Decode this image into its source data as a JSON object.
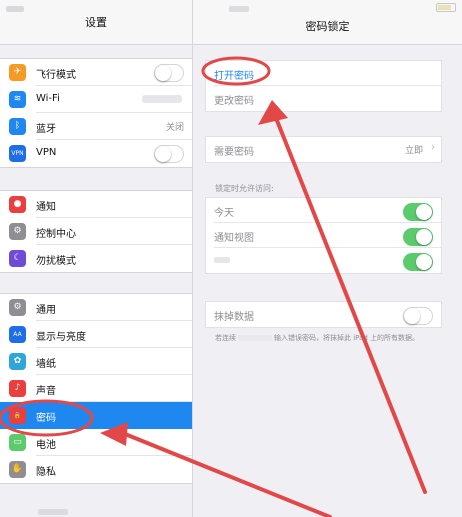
{
  "left": {
    "title": "设置",
    "groups": [
      [
        {
          "label": "飞行模式",
          "icon": "airplane-icon",
          "color": "#f59a23",
          "glyph": "✈",
          "toggle": false
        },
        {
          "label": "Wi-Fi",
          "icon": "wifi-icon",
          "color": "#1f88f0",
          "glyph": "≋"
        },
        {
          "label": "蓝牙",
          "icon": "bluetooth-icon",
          "color": "#1f88f0",
          "glyph": "ᛒ",
          "value": "关闭"
        },
        {
          "label": "VPN",
          "icon": "vpn-icon",
          "color": "#1f6ee8",
          "glyph": "VPN",
          "toggle": false
        }
      ],
      [
        {
          "label": "通知",
          "icon": "notifications-icon",
          "color": "#ea3f3f",
          "glyph": "●"
        },
        {
          "label": "控制中心",
          "icon": "control-center-icon",
          "color": "#8e8e93",
          "glyph": "⚙"
        },
        {
          "label": "勿扰模式",
          "icon": "do-not-disturb-icon",
          "color": "#6f4bd6",
          "glyph": "☾"
        }
      ],
      [
        {
          "label": "通用",
          "icon": "general-icon",
          "color": "#8e8e93",
          "glyph": "⚙"
        },
        {
          "label": "显示与亮度",
          "icon": "display-icon",
          "color": "#1f6ee8",
          "glyph": "AA"
        },
        {
          "label": "墙纸",
          "icon": "wallpaper-icon",
          "color": "#2ea7d8",
          "glyph": "✿"
        },
        {
          "label": "声音",
          "icon": "sounds-icon",
          "color": "#ea3f3f",
          "glyph": "♪"
        },
        {
          "label": "密码",
          "icon": "passcode-icon",
          "color": "#ea3f3f",
          "glyph": "🔒",
          "selected": true
        },
        {
          "label": "电池",
          "icon": "battery-icon",
          "color": "#5bcb6c",
          "glyph": "▭"
        },
        {
          "label": "隐私",
          "icon": "privacy-icon",
          "color": "#8e8e93",
          "glyph": "✋"
        }
      ]
    ]
  },
  "right": {
    "title": "密码锁定",
    "group1": [
      {
        "label": "打开密码",
        "blue": true
      },
      {
        "label": "更改密码",
        "blue": false
      }
    ],
    "require": {
      "label": "需要密码",
      "value": "立即"
    },
    "allow_header": "锁定时允许访问:",
    "allow": [
      {
        "label": "今天",
        "on": true
      },
      {
        "label": "通知视图",
        "on": true
      },
      {
        "label": "",
        "on": true
      }
    ],
    "erase": {
      "label": "抹掉数据",
      "on": false
    },
    "note_a": "若连续",
    "note_b": "输入错误密码，将抹掉此 iPad 上的所有数据。"
  },
  "annotation_color": "#e34848"
}
